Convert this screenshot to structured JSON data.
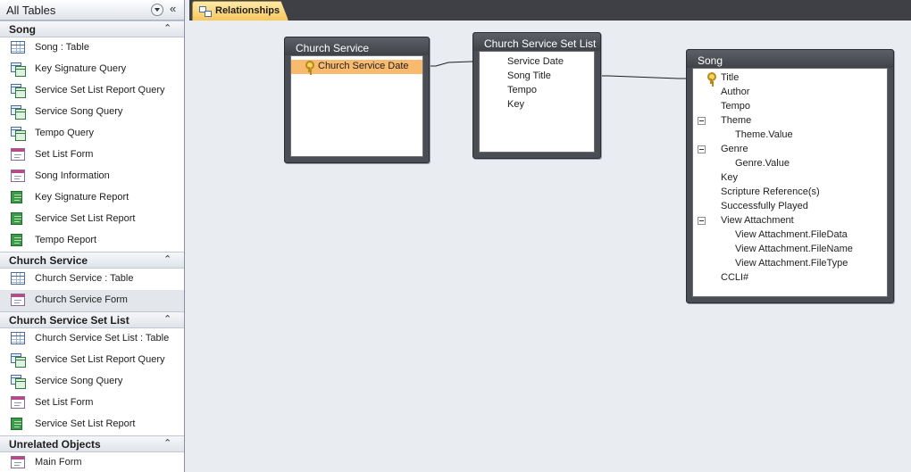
{
  "nav": {
    "title": "All Tables",
    "collapse_glyph": "«",
    "groups": [
      {
        "title": "Song",
        "toggle": "⌃",
        "items": [
          {
            "label": "Song : Table",
            "icon": "table-icon"
          },
          {
            "label": "Key Signature Query",
            "icon": "query-icon"
          },
          {
            "label": "Service Set List Report Query",
            "icon": "query-icon"
          },
          {
            "label": "Service Song Query",
            "icon": "query-icon"
          },
          {
            "label": "Tempo Query",
            "icon": "query-icon"
          },
          {
            "label": "Set List Form",
            "icon": "form-icon"
          },
          {
            "label": "Song Information",
            "icon": "form-icon"
          },
          {
            "label": "Key Signature Report",
            "icon": "report-icon"
          },
          {
            "label": "Service Set List Report",
            "icon": "report-icon"
          },
          {
            "label": "Tempo Report",
            "icon": "report-icon"
          }
        ]
      },
      {
        "title": "Church Service",
        "toggle": "⌃",
        "items": [
          {
            "label": "Church Service : Table",
            "icon": "table-icon"
          },
          {
            "label": "Church Service Form",
            "icon": "form-icon",
            "selected": true
          }
        ]
      },
      {
        "title": "Church Service Set List",
        "toggle": "⌃",
        "items": [
          {
            "label": "Church Service Set List : Table",
            "icon": "table-icon"
          },
          {
            "label": "Service Set List Report Query",
            "icon": "query-icon"
          },
          {
            "label": "Service Song Query",
            "icon": "query-icon"
          },
          {
            "label": "Set List Form",
            "icon": "form-icon"
          },
          {
            "label": "Service Set List Report",
            "icon": "report-icon"
          }
        ]
      },
      {
        "title": "Unrelated Objects",
        "toggle": "⌃",
        "items": [
          {
            "label": "Main Form",
            "icon": "form-icon"
          }
        ]
      }
    ]
  },
  "tab": {
    "label": "Relationships",
    "icon": "relationships-icon"
  },
  "tables": {
    "church_service": {
      "title": "Church Service",
      "fields": [
        {
          "label": "Church Service Date",
          "key": true,
          "selected": true
        }
      ]
    },
    "set_list": {
      "title": "Church Service Set List",
      "fields": [
        {
          "label": "Service Date"
        },
        {
          "label": "Song Title"
        },
        {
          "label": "Tempo"
        },
        {
          "label": "Key"
        }
      ]
    },
    "song": {
      "title": "Song",
      "fields": [
        {
          "label": "Title",
          "key": true
        },
        {
          "label": "Author"
        },
        {
          "label": "Tempo"
        },
        {
          "label": "Theme",
          "expand": true
        },
        {
          "label": "Theme.Value",
          "child": true
        },
        {
          "label": "Genre",
          "expand": true
        },
        {
          "label": "Genre.Value",
          "child": true
        },
        {
          "label": "Key"
        },
        {
          "label": "Scripture Reference(s)"
        },
        {
          "label": "Successfully Played"
        },
        {
          "label": "View Attachment",
          "expand": true
        },
        {
          "label": "View Attachment.FileData",
          "child": true
        },
        {
          "label": "View Attachment.FileName",
          "child": true
        },
        {
          "label": "View Attachment.FileType",
          "child": true
        },
        {
          "label": "CCLI#"
        }
      ]
    }
  },
  "colors": {
    "selected_field": "#f8ba6e",
    "tab_active": "#f7c75b",
    "table_frame": "#4a4d53"
  }
}
